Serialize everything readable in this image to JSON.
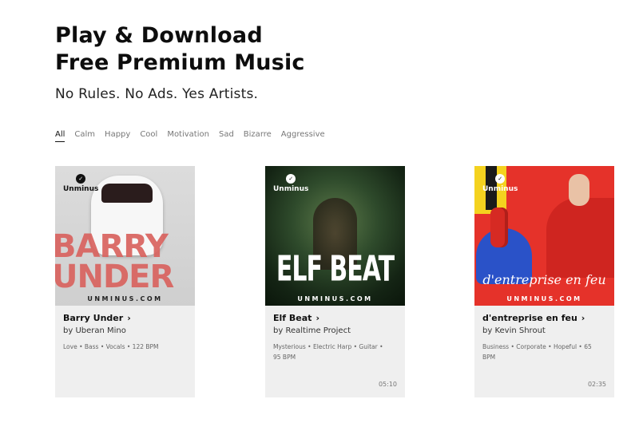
{
  "hero": {
    "title_line1": "Play & Download",
    "title_line2": "Free Premium Music",
    "subtitle": "No Rules. No Ads. Yes Artists."
  },
  "filters": [
    "All",
    "Calm",
    "Happy",
    "Cool",
    "Motivation",
    "Sad",
    "Bizarre",
    "Aggressive"
  ],
  "active_filter": "All",
  "cards": [
    {
      "brand": "Unminus",
      "cover_text": "BARRY UNDER",
      "site": "UNMINUS.COM",
      "title": "Barry Under",
      "artist": "by Uberan Mino",
      "tags": "Love • Bass • Vocals • 122 BPM",
      "duration": ""
    },
    {
      "brand": "Unminus",
      "cover_text": "ELF BEAT",
      "site": "UNMINUS.COM",
      "title": "Elf Beat",
      "artist": "by Realtime Project",
      "tags": "Mysterious • Electric Harp • Guitar • 95 BPM",
      "duration": "05:10"
    },
    {
      "brand": "Unminus",
      "cover_text": "d'entreprise en feu",
      "site": "UNMINUS.COM",
      "title": "d'entreprise en feu",
      "artist": "by Kevin Shrout",
      "tags": "Business • Corporate • Hopeful • 65 BPM",
      "duration": "02:35"
    }
  ],
  "icons": {
    "chevron": "chevron-right-icon",
    "logo": "unminus-logo-icon"
  }
}
